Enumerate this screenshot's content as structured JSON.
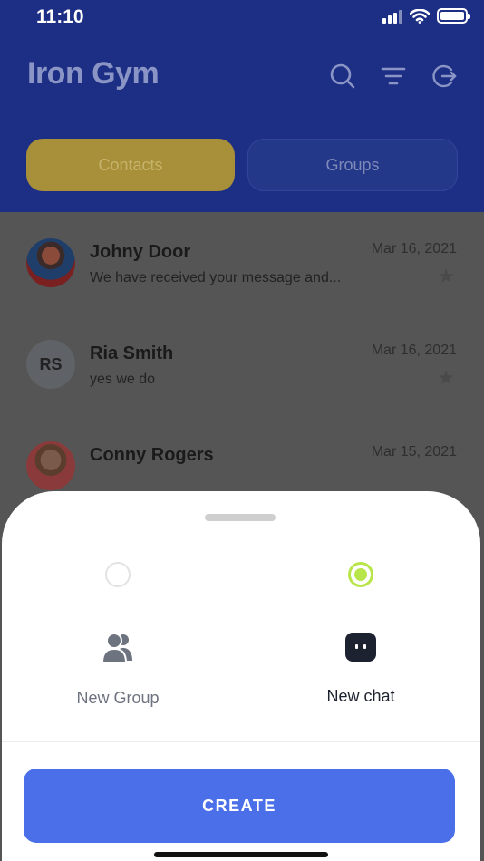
{
  "status_bar": {
    "time": "11:10"
  },
  "header": {
    "title": "Iron Gym",
    "icons": [
      "search-icon",
      "filter-icon",
      "logout-icon"
    ]
  },
  "tabs": [
    {
      "label": "Contacts",
      "active": true
    },
    {
      "label": "Groups",
      "active": false
    }
  ],
  "contacts": [
    {
      "name": "Johny Door",
      "message": "We have received your message and...",
      "date": "Mar 16, 2021",
      "avatar": "photo"
    },
    {
      "name": "Ria Smith",
      "message": "yes we do",
      "date": "Mar 16, 2021",
      "avatar": "RS"
    },
    {
      "name": "Conny Rogers",
      "message": "",
      "date": "Mar 15, 2021",
      "avatar": "photo"
    }
  ],
  "sheet": {
    "options": [
      {
        "label": "New Group",
        "selected": false,
        "icon": "users-icon"
      },
      {
        "label": "New chat",
        "selected": true,
        "icon": "chat-icon"
      }
    ],
    "create_label": "CREATE"
  },
  "colors": {
    "header": "#1d2f84",
    "tab_active": "#e8b820",
    "primary_button": "#4a6fe8",
    "radio_selected": "#b8e64a"
  }
}
